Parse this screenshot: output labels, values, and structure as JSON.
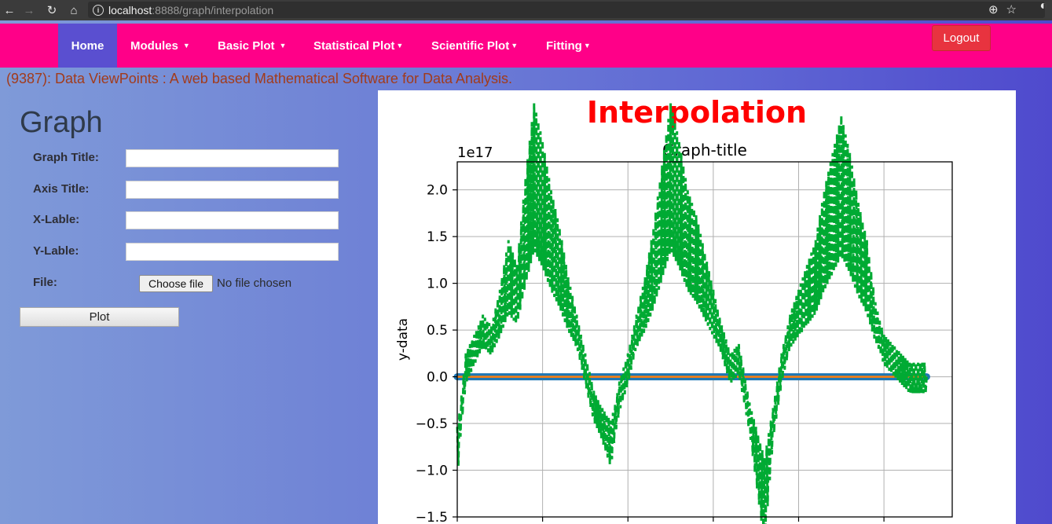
{
  "browser": {
    "url_host": "localhost",
    "url_rest": ":8888/graph/interpolation",
    "back_icon": "back-arrow-icon",
    "forward_icon": "forward-arrow-icon",
    "reload_icon": "reload-icon",
    "home_icon": "home-icon"
  },
  "navbar": {
    "items": [
      {
        "label": "Home",
        "caret": ""
      },
      {
        "label": "Modules",
        "caret": "▼"
      },
      {
        "label": "Basic Plot",
        "caret": "▼"
      },
      {
        "label": "Statistical Plot",
        "caret": "▼"
      },
      {
        "label": "Scientific Plot",
        "caret": "▼"
      },
      {
        "label": "Fitting",
        "caret": "▼"
      }
    ],
    "logout": "Logout"
  },
  "tagline": "(9387): Data ViewPoints : A web based Mathematical Software for Data Analysis.",
  "form": {
    "title": "Graph",
    "graph_title_label": "Graph Title:",
    "axis_title_label": "Axis Title:",
    "xlabel_label": "X-Lable:",
    "ylabel_label": "Y-Lable:",
    "file_label": "File:",
    "choose_file": "Choose file",
    "file_status": "No file chosen",
    "plot_button": "Plot"
  },
  "chart_heading": "Interpolation",
  "chart_data": {
    "type": "line",
    "title": "Graph-title",
    "ylabel": "y-data",
    "xlabel": "",
    "offset_label": "1e17",
    "ylim": [
      -1.5,
      2.3
    ],
    "yticks": [
      -1.5,
      -1.0,
      -0.5,
      0.0,
      0.5,
      1.0,
      1.5,
      2.0
    ],
    "ytick_labels": [
      "−1.5",
      "−1.0",
      "−0.5",
      "0.0",
      "0.5",
      "1.0",
      "1.5",
      "2.0"
    ],
    "xlim": [
      0,
      5.8
    ],
    "xticks": [
      0,
      1,
      2,
      3,
      4,
      5
    ],
    "grid": true,
    "series": [
      {
        "color": "#1f77b4",
        "style": "marker-line",
        "x": [
          0,
          5.5
        ],
        "y": [
          0.0,
          0.0
        ]
      },
      {
        "color": "#ff7f0e",
        "style": "solid",
        "x": [
          0,
          5.5
        ],
        "y": [
          0.0,
          0.0
        ]
      },
      {
        "color": "#00aa33",
        "style": "dashed",
        "x": [
          0.0,
          0.1,
          0.2,
          0.3,
          0.4,
          0.5,
          0.6,
          0.7,
          0.8,
          0.9,
          1.0,
          1.1,
          1.2,
          1.3,
          1.4,
          1.5,
          1.6,
          1.7,
          1.8,
          1.9,
          2.0,
          2.1,
          2.2,
          2.3,
          2.4,
          2.5,
          2.6,
          2.7,
          2.8,
          2.9,
          3.0,
          3.1,
          3.2,
          3.3,
          3.4,
          3.5,
          3.6,
          3.7,
          3.8,
          3.9,
          4.0,
          4.1,
          4.2,
          4.3,
          4.4,
          4.5,
          4.6,
          4.7,
          4.8,
          4.9,
          5.0,
          5.1,
          5.2,
          5.3,
          5.4,
          5.5
        ],
        "y": [
          -0.8,
          0.1,
          0.3,
          0.5,
          0.4,
          0.7,
          1.1,
          0.9,
          1.6,
          2.2,
          1.9,
          1.5,
          1.2,
          0.8,
          0.5,
          0.1,
          -0.3,
          -0.5,
          -0.7,
          -0.2,
          0.1,
          0.5,
          0.8,
          1.2,
          1.7,
          2.2,
          1.9,
          1.5,
          1.3,
          1.0,
          0.7,
          0.4,
          0.1,
          0.2,
          -0.3,
          -0.8,
          -1.3,
          -0.5,
          0.1,
          0.5,
          0.7,
          0.9,
          1.1,
          1.5,
          1.8,
          2.1,
          1.8,
          1.4,
          1.1,
          0.6,
          0.3,
          0.2,
          0.1,
          0.0,
          0.0,
          0.0
        ]
      }
    ]
  }
}
